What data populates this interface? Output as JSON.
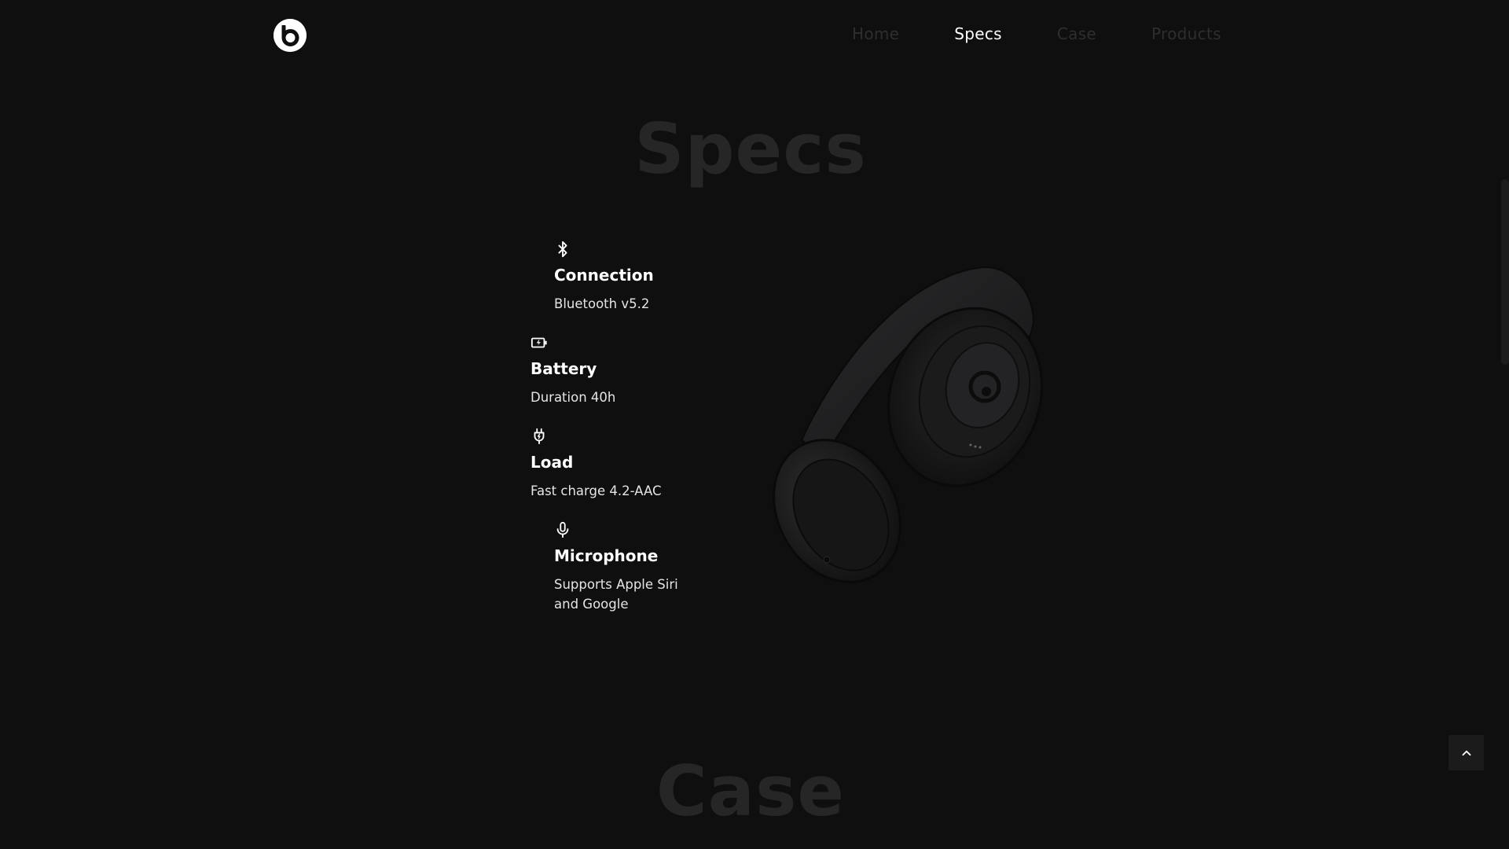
{
  "nav": {
    "items": [
      {
        "label": "Home",
        "active": false
      },
      {
        "label": "Specs",
        "active": true
      },
      {
        "label": "Case",
        "active": false
      },
      {
        "label": "Products",
        "active": false
      }
    ]
  },
  "sections": {
    "specs_title": "Specs",
    "case_title": "Case"
  },
  "specs": [
    {
      "icon": "bluetooth-icon",
      "label": "Connection",
      "value": "Bluetooth v5.2"
    },
    {
      "icon": "battery-charging-icon",
      "label": "Battery",
      "value": "Duration 40h"
    },
    {
      "icon": "plug-icon",
      "label": "Load",
      "value": "Fast charge 4.2-AAC"
    },
    {
      "icon": "microphone-icon",
      "label": "Microphone",
      "value": "Supports Apple Siri and Google"
    }
  ],
  "colors": {
    "background": "#0f0f10",
    "active_nav": "#ffffff",
    "inactive_nav": "#2e2e2e",
    "section_title": "#262626"
  }
}
